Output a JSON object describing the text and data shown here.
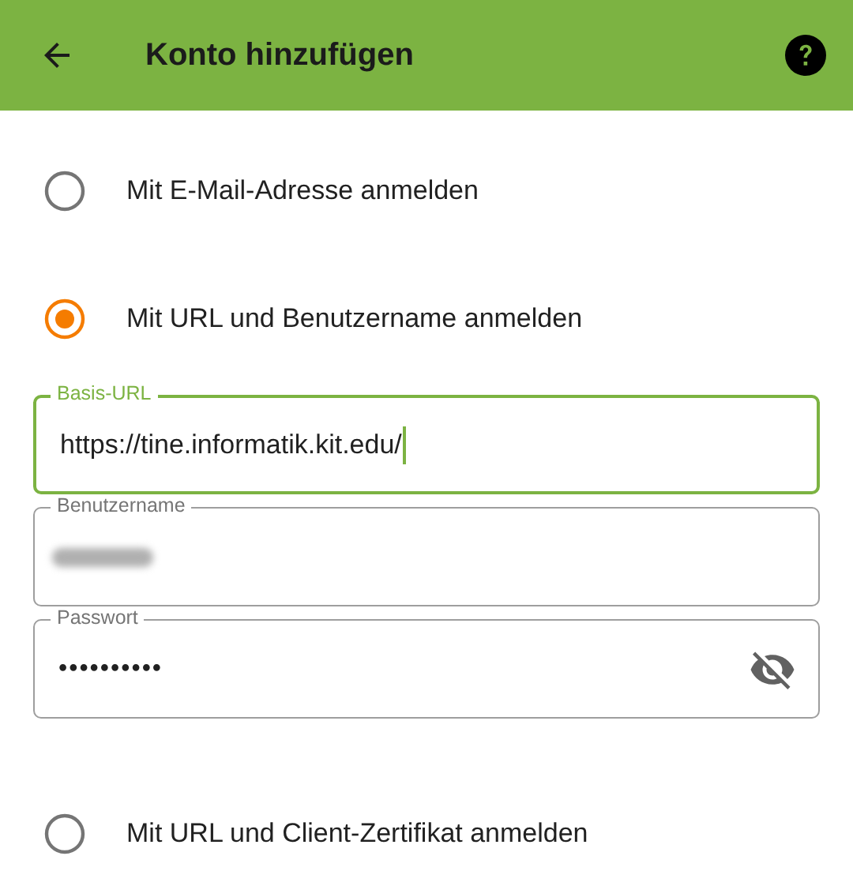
{
  "app_bar": {
    "title": "Konto hinzufügen"
  },
  "options": [
    {
      "label": "Mit E-Mail-Adresse anmelden",
      "selected": false
    },
    {
      "label": "Mit URL und Benutzername anmelden",
      "selected": true,
      "fields": [
        {
          "kind": "text",
          "label": "Basis-URL",
          "value": "https://tine.informatik.kit.edu/",
          "focused": true
        },
        {
          "kind": "blurred",
          "label": "Benutzername",
          "focused": false
        },
        {
          "kind": "password",
          "label": "Passwort",
          "value": "••••••••••",
          "focused": false
        }
      ]
    },
    {
      "label": "Mit URL und Client-Zertifikat anmelden",
      "selected": false
    }
  ]
}
